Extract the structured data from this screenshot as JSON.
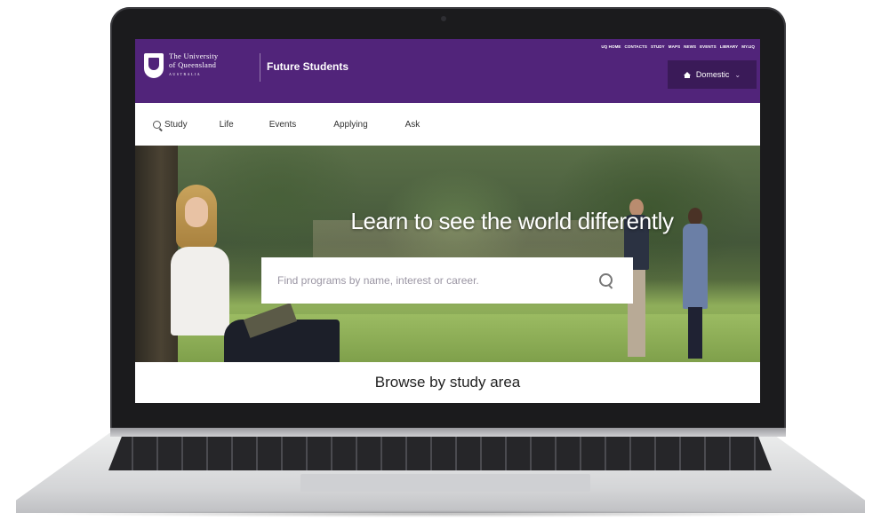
{
  "header": {
    "logo": {
      "line1": "The University",
      "line2": "of Queensland",
      "line3": "AUSTRALIA"
    },
    "site_title": "Future Students",
    "utility_links": [
      "UQ HOME",
      "CONTACTS",
      "STUDY",
      "MAPS",
      "NEWS",
      "EVENTS",
      "LIBRARY",
      "MY.UQ"
    ],
    "audience_selector": {
      "label": "Domestic",
      "icon": "home-icon"
    },
    "colors": {
      "brand_purple": "#51247a",
      "dark_purple": "#3a1a58"
    }
  },
  "nav": {
    "items": [
      {
        "label": "Study",
        "icon": "search-icon"
      },
      {
        "label": "Life"
      },
      {
        "label": "Events"
      },
      {
        "label": "Applying"
      },
      {
        "label": "Ask"
      }
    ]
  },
  "hero": {
    "headline": "Learn to see the world differently",
    "search": {
      "placeholder": "Find programs by name, interest or career.",
      "value": ""
    }
  },
  "main": {
    "section_title": "Browse by study area"
  }
}
